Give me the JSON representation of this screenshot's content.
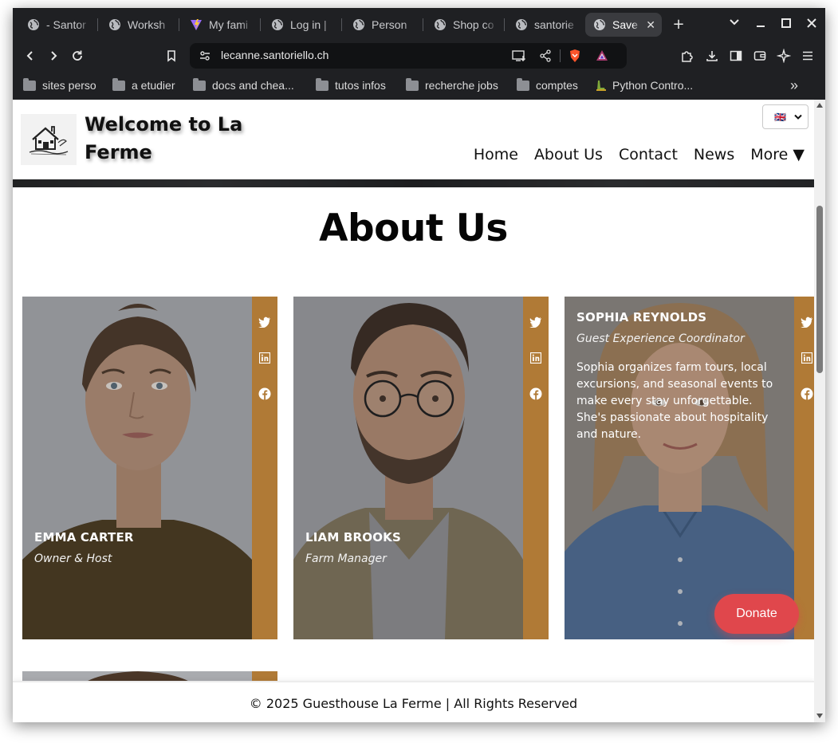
{
  "browser": {
    "tabs": [
      {
        "label": "- Santor",
        "icon": "globe-icon"
      },
      {
        "label": "Worksh",
        "icon": "globe-icon"
      },
      {
        "label": "My fami",
        "icon": "vite-icon"
      },
      {
        "label": "Log in |",
        "icon": "globe-icon"
      },
      {
        "label": "Person",
        "icon": "globe-icon"
      },
      {
        "label": "Shop co",
        "icon": "globe-icon"
      },
      {
        "label": "santorie",
        "icon": "globe-icon"
      },
      {
        "label": "Save",
        "icon": "globe-icon",
        "active": true
      }
    ],
    "url": "lecanne.santoriello.ch",
    "bookmarks": [
      {
        "label": "sites perso"
      },
      {
        "label": "a etudier"
      },
      {
        "label": "docs and chea..."
      },
      {
        "label": "tutos infos"
      },
      {
        "label": "recherche jobs"
      },
      {
        "label": "comptes"
      },
      {
        "label": "Python Contro..."
      }
    ],
    "accent_color": "#1f2023"
  },
  "site": {
    "title": "Welcome to La Ferme",
    "language_flag": "🇬🇧",
    "nav": [
      "Home",
      "About Us",
      "Contact",
      "News",
      "More ▼"
    ],
    "page_title": "About Us",
    "team": [
      {
        "name": "EMMA CARTER",
        "role": "Owner & Host",
        "bio": ""
      },
      {
        "name": "LIAM BROOKS",
        "role": "Farm Manager",
        "bio": ""
      },
      {
        "name": "SOPHIA REYNOLDS",
        "role": "Guest Experience Coordinator",
        "bio": "Sophia organizes farm tours, local excursions, and seasonal events to make every stay unforgettable. She's passionate about hospitality and nature."
      }
    ],
    "donate_label": "Donate",
    "footer": "© 2025 Guesthouse La Ferme | All Rights Reserved",
    "colors": {
      "social_bar": "#b07a36",
      "donate": "#e0474c"
    }
  }
}
